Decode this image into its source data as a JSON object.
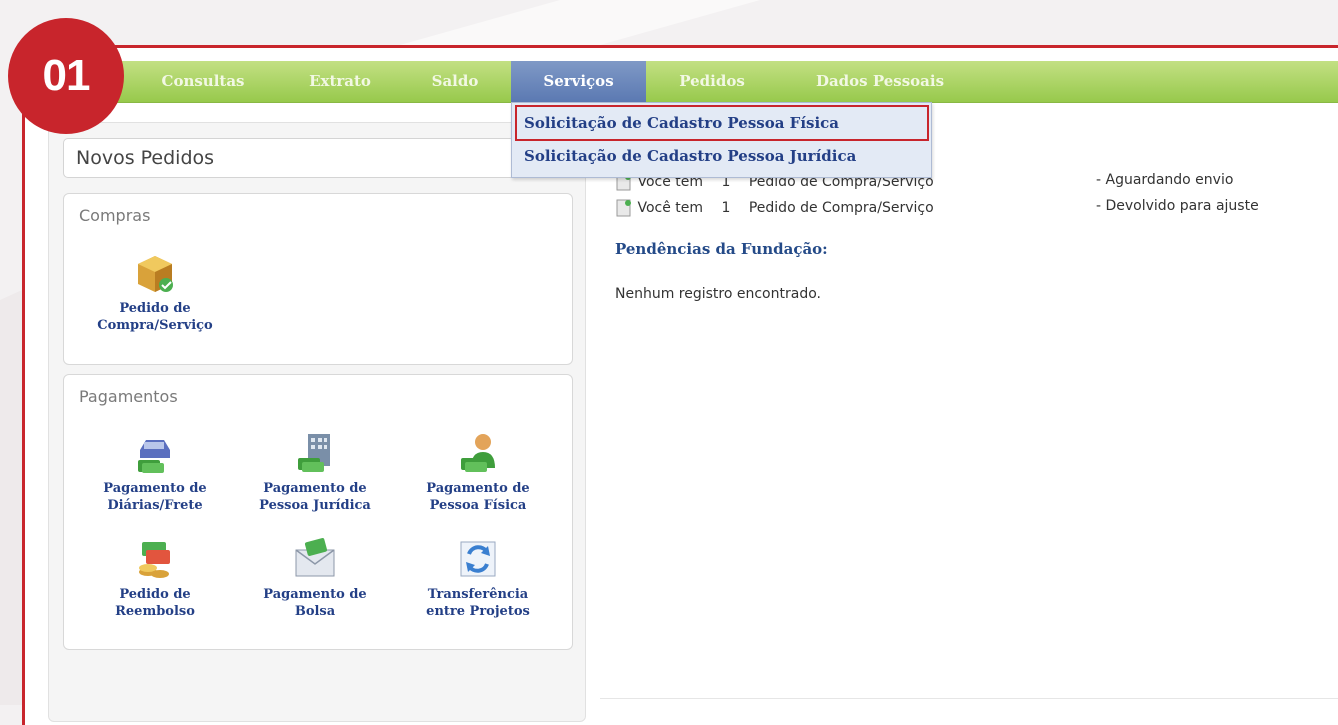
{
  "step_badge": "01",
  "colors": {
    "brand_red": "#c8252c",
    "nav_green": "#a7d061",
    "nav_active": "#6a87bd",
    "link_blue": "#233f86"
  },
  "nav": {
    "items": [
      {
        "label": "Consultas",
        "active": false
      },
      {
        "label": "Extrato",
        "active": false
      },
      {
        "label": "Saldo",
        "active": false
      },
      {
        "label": "Serviços",
        "active": true
      },
      {
        "label": "Pedidos",
        "active": false
      },
      {
        "label": "Dados Pessoais",
        "active": false
      }
    ]
  },
  "dropdown": {
    "items": [
      {
        "label": "Solicitação de Cadastro Pessoa Física",
        "highlighted": true
      },
      {
        "label": "Solicitação de Cadastro Pessoa Jurídica",
        "highlighted": false
      }
    ]
  },
  "left_panel": {
    "title": "Novos Pedidos",
    "compras": {
      "title": "Compras",
      "tiles": [
        {
          "label": "Pedido de\nCompra/Serviço",
          "icon": "box-icon"
        }
      ]
    },
    "pagamentos": {
      "title": "Pagamentos",
      "tiles": [
        {
          "label": "Pagamento de\nDiárias/Frete",
          "icon": "car-money-icon"
        },
        {
          "label": "Pagamento de\nPessoa Jurídica",
          "icon": "building-money-icon"
        },
        {
          "label": "Pagamento de\nPessoa Física",
          "icon": "person-money-icon"
        },
        {
          "label": "Pedido de\nReembolso",
          "icon": "coins-refund-icon"
        },
        {
          "label": "Pagamento de\nBolsa",
          "icon": "envelope-icon"
        },
        {
          "label": "Transferência\nentre Projetos",
          "icon": "transfer-icon"
        }
      ]
    }
  },
  "status": {
    "rows": [
      {
        "prefix": "Você tem",
        "count": "1",
        "item": "Pedido de Compra/Serviço",
        "status": "- Aguardando envio"
      },
      {
        "prefix": "Você tem",
        "count": "1",
        "item": "Pedido de Compra/Serviço",
        "status": "- Devolvido para ajuste"
      }
    ],
    "pendencias_title": "Pendências da Fundação:",
    "empty_message": "Nenhum registro encontrado."
  }
}
